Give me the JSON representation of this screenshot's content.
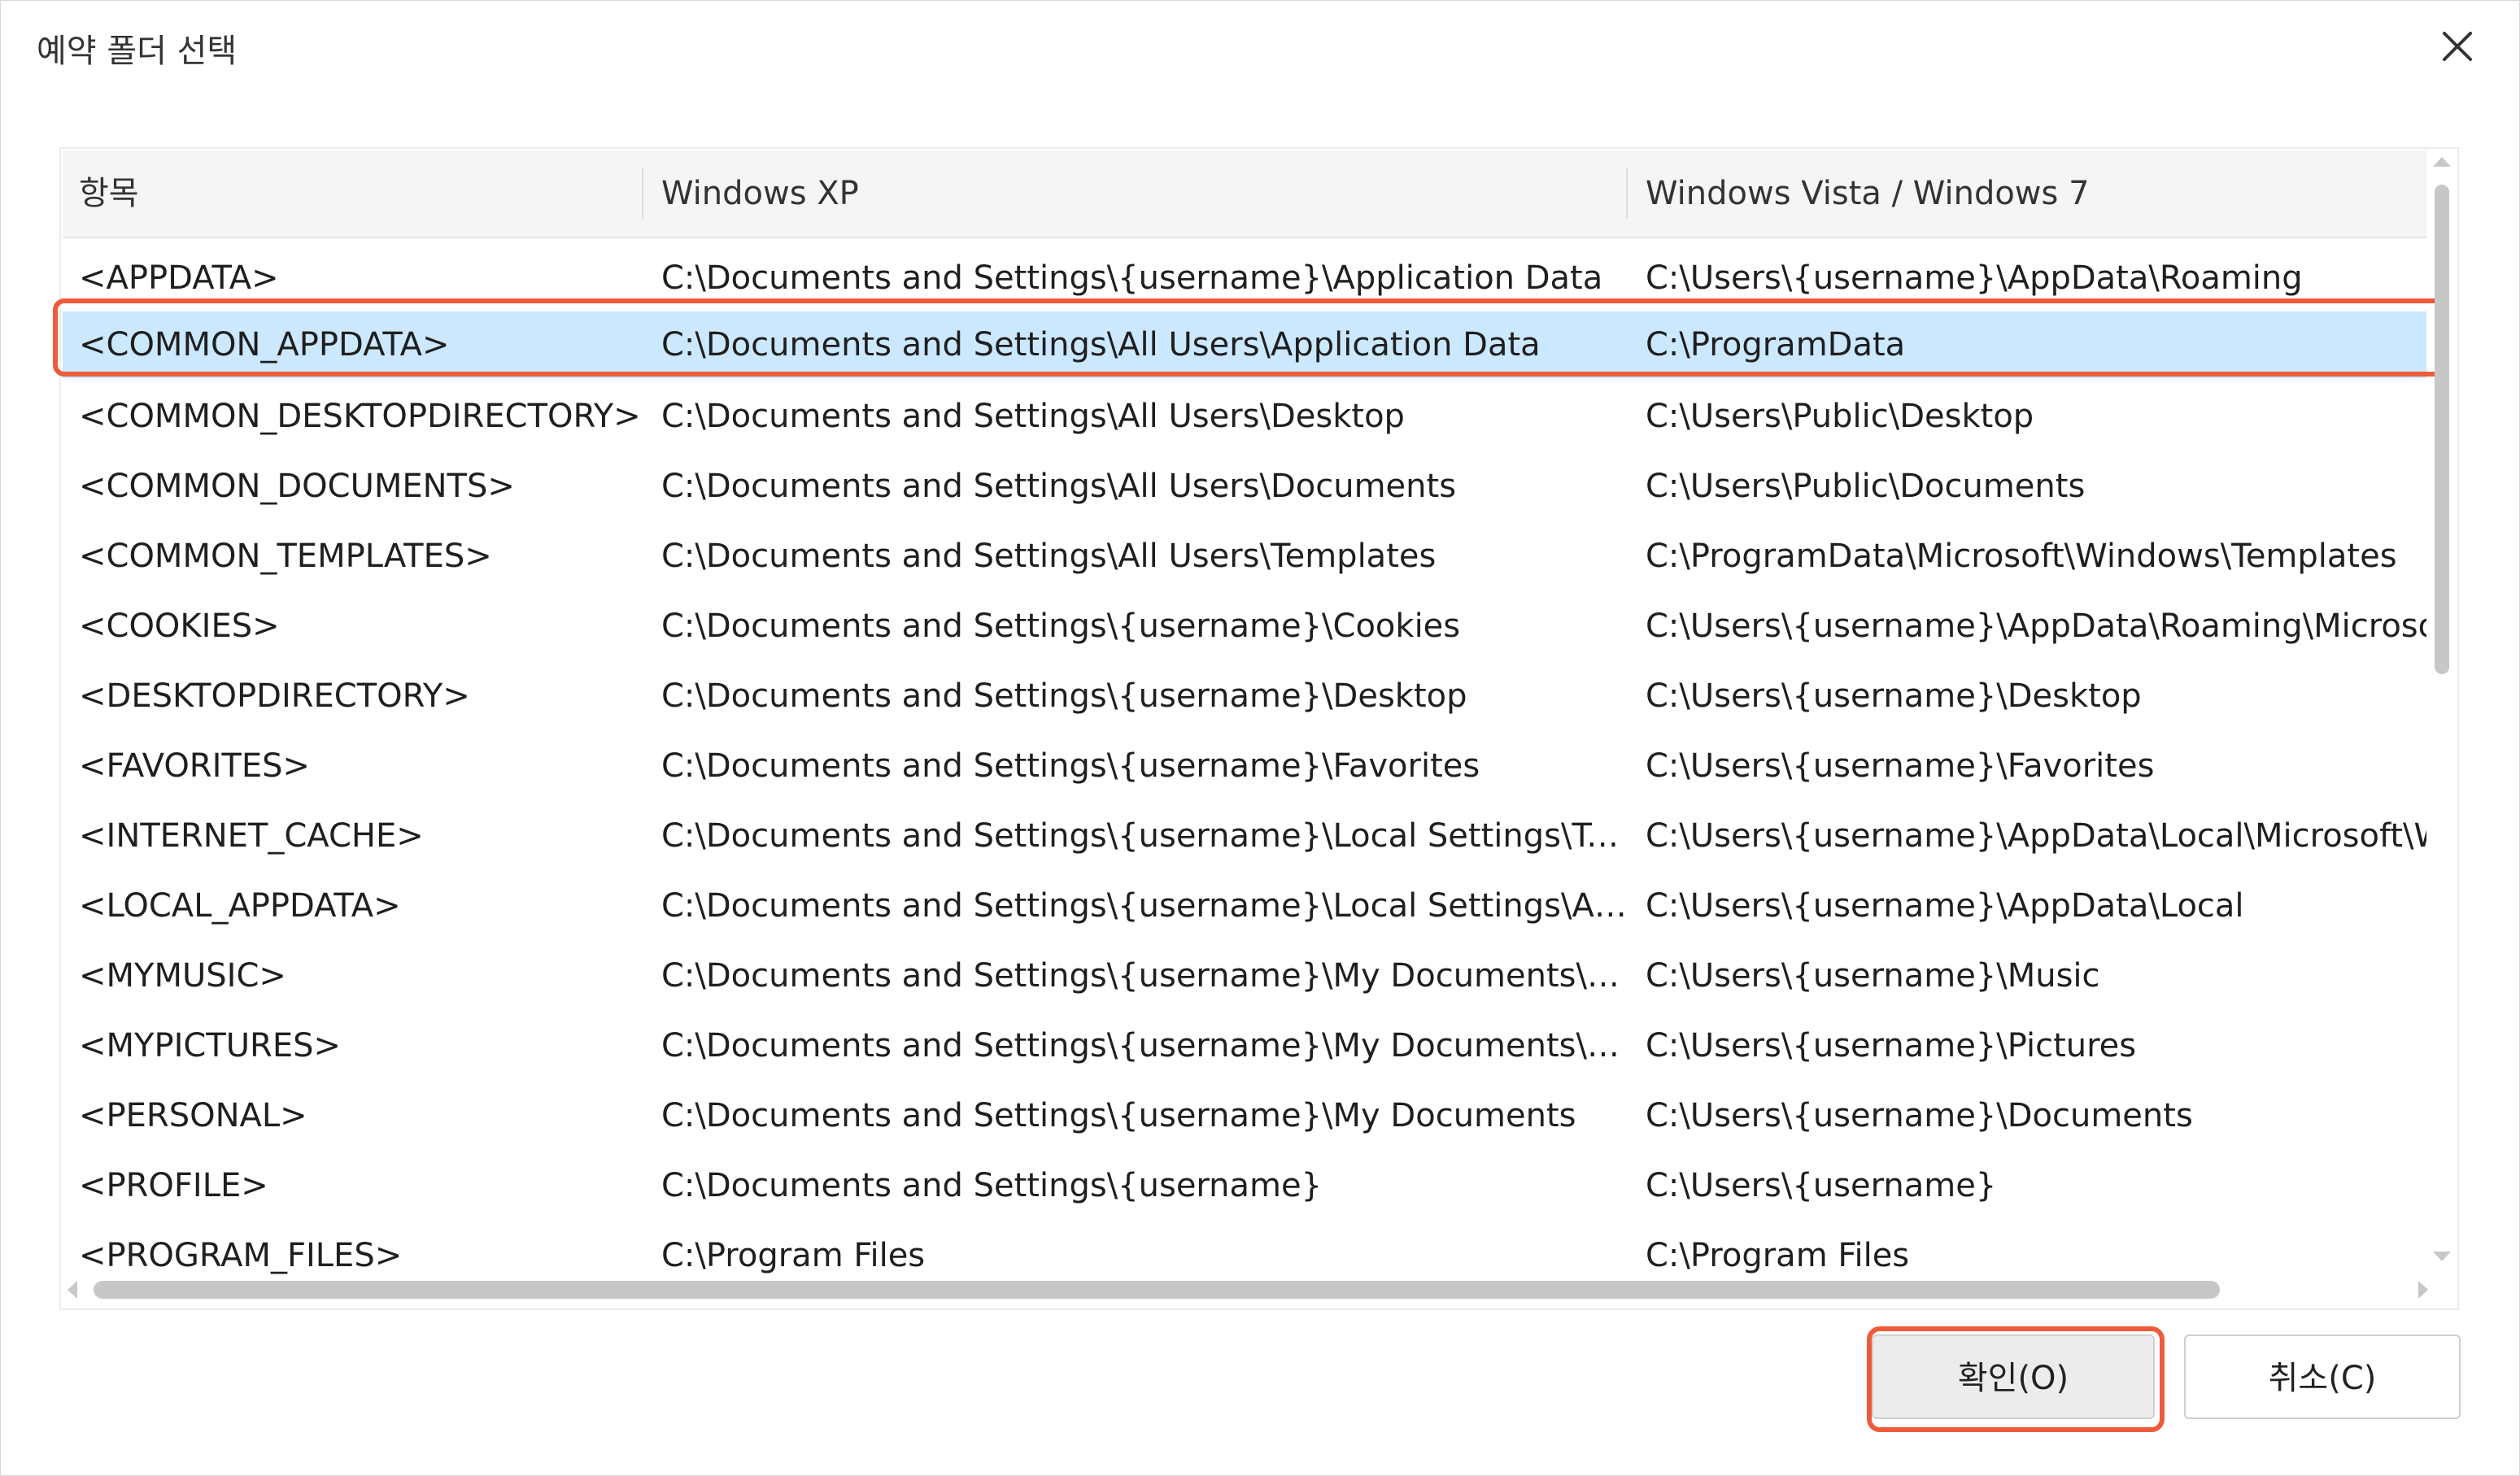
{
  "dialog": {
    "title": "예약 폴더 선택"
  },
  "columns": [
    {
      "label": "항목"
    },
    {
      "label": "Windows XP"
    },
    {
      "label": "Windows Vista / Windows 7"
    }
  ],
  "rows": [
    {
      "item": "<APPDATA>",
      "xp": "C:\\Documents and Settings\\{username}\\Application Data",
      "vista": "C:\\Users\\{username}\\AppData\\Roaming"
    },
    {
      "item": "<COMMON_APPDATA>",
      "xp": "C:\\Documents and Settings\\All Users\\Application Data",
      "vista": "C:\\ProgramData"
    },
    {
      "item": "<COMMON_DESKTOPDIRECTORY>",
      "xp": "C:\\Documents and Settings\\All Users\\Desktop",
      "vista": "C:\\Users\\Public\\Desktop"
    },
    {
      "item": "<COMMON_DOCUMENTS>",
      "xp": "C:\\Documents and Settings\\All Users\\Documents",
      "vista": "C:\\Users\\Public\\Documents"
    },
    {
      "item": "<COMMON_TEMPLATES>",
      "xp": "C:\\Documents and Settings\\All Users\\Templates",
      "vista": "C:\\ProgramData\\Microsoft\\Windows\\Templates"
    },
    {
      "item": "<COOKIES>",
      "xp": "C:\\Documents and Settings\\{username}\\Cookies",
      "vista": "C:\\Users\\{username}\\AppData\\Roaming\\Microsoft"
    },
    {
      "item": "<DESKTOPDIRECTORY>",
      "xp": "C:\\Documents and Settings\\{username}\\Desktop",
      "vista": "C:\\Users\\{username}\\Desktop"
    },
    {
      "item": "<FAVORITES>",
      "xp": "C:\\Documents and Settings\\{username}\\Favorites",
      "vista": "C:\\Users\\{username}\\Favorites"
    },
    {
      "item": "<INTERNET_CACHE>",
      "xp": "C:\\Documents and Settings\\{username}\\Local Settings\\Te···",
      "vista": "C:\\Users\\{username}\\AppData\\Local\\Microsoft\\Wi"
    },
    {
      "item": "<LOCAL_APPDATA>",
      "xp": "C:\\Documents and Settings\\{username}\\Local Settings\\Ap···",
      "vista": "C:\\Users\\{username}\\AppData\\Local"
    },
    {
      "item": "<MYMUSIC>",
      "xp": "C:\\Documents and Settings\\{username}\\My Documents\\M···",
      "vista": "C:\\Users\\{username}\\Music"
    },
    {
      "item": "<MYPICTURES>",
      "xp": "C:\\Documents and Settings\\{username}\\My Documents\\M···",
      "vista": "C:\\Users\\{username}\\Pictures"
    },
    {
      "item": "<PERSONAL>",
      "xp": "C:\\Documents and Settings\\{username}\\My Documents",
      "vista": "C:\\Users\\{username}\\Documents"
    },
    {
      "item": "<PROFILE>",
      "xp": "C:\\Documents and Settings\\{username}",
      "vista": "C:\\Users\\{username}"
    },
    {
      "item": "<PROGRAM_FILES>",
      "xp": "C:\\Program Files",
      "vista": "C:\\Program Files"
    }
  ],
  "selected_row": 1,
  "buttons": {
    "ok_label": "확인(O)",
    "cancel_label": "취소(C)"
  },
  "colors": {
    "selection": "#cce8ff",
    "highlight_outline": "#ee5b3b"
  },
  "icons": {
    "close": "close-icon"
  }
}
